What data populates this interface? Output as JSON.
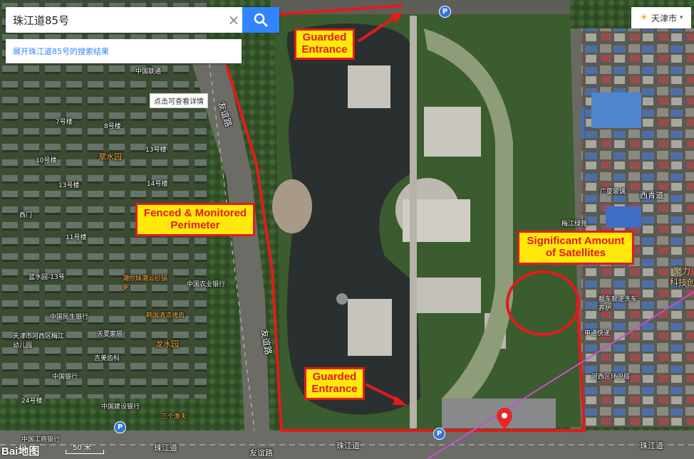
{
  "search": {
    "value": "珠江道85号",
    "clear_label": "×"
  },
  "result_expand": "展开珠江道85号的搜索结果",
  "city_selector": {
    "label": "天津市",
    "icon": "weather-sun-icon"
  },
  "callouts": {
    "guarded_entrance_north": "Guarded\nEntrance",
    "perimeter": "Fenced & Monitored\nPerimeter",
    "satellites": "Significant Amount\nof Satellites",
    "guarded_entrance_south": "Guarded\nEntrance"
  },
  "poi_tip": "点击可查看详情",
  "map_labels": {
    "bank_china_unicom": "中国联通",
    "n7": "7号楼",
    "n10": "10号楼",
    "n13a": "13号楼",
    "n14": "14号楼",
    "n13b": "13号楼",
    "n11": "11号楼",
    "n8": "8号楼",
    "cuishuiyuan": "翠水园",
    "ximen": "西门",
    "road_youyi_1": "友谊路",
    "road_youyi_2": "友谊路",
    "road_youyi_3": "友谊路",
    "lanshuiyuan": "蓝水园-13号",
    "chaozhou": "潮你妹潮汕砂锅粥",
    "agri_bank": "中国农业银行",
    "minsheng": "中国民生银行",
    "hanguo": "韩国清凉烤肉",
    "tianjin_kg": "天津市河西区梅江幼儿园",
    "tianxia": "天夏家居",
    "longshuiyuan": "龙水园",
    "jimei": "吉美齿科",
    "boc": "中国银行",
    "ccb": "中国建设银行",
    "sanjun": "三个渔夫",
    "icbc": "中国工商银行",
    "n24": "24号楼",
    "guangsha": "广厦玻璃",
    "meijiang": "梅江绿苑",
    "xiqingdao": "西青道",
    "jiangjun": "聚力",
    "keji": "科技创",
    "che": "靓车靓途洗车养护",
    "shentong": "申通快递",
    "hexi_health": "河西区环卫局",
    "zhujiangdao_1": "珠江道",
    "zhujiangdao_2": "珠江道",
    "zhujiangdao_3": "珠江道",
    "youyi_bottom": "友谊路"
  },
  "scale": "50 米",
  "baidu_logo": "Bai地图",
  "colors": {
    "accent": "#3385ff",
    "callout_fill": "#ffe90a",
    "callout_border": "#e21b1b"
  }
}
